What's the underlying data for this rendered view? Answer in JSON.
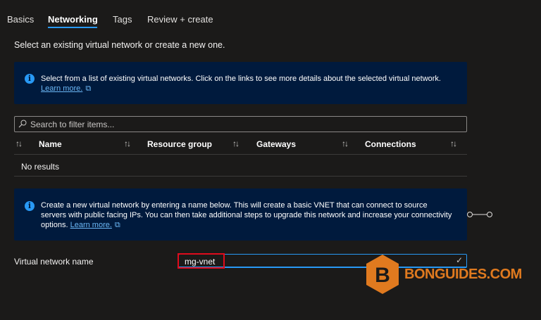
{
  "tabs": [
    {
      "label": "Basics",
      "active": false
    },
    {
      "label": "Networking",
      "active": true
    },
    {
      "label": "Tags",
      "active": false
    },
    {
      "label": "Review + create",
      "active": false
    }
  ],
  "intro_text": "Select an existing virtual network or create a new one.",
  "info_existing": {
    "text": "Select from a list of existing virtual networks. Click on the links to see more details about the selected virtual network.",
    "link": "Learn more."
  },
  "filter": {
    "placeholder": "Search to filter items..."
  },
  "table": {
    "columns": [
      "Name",
      "Resource group",
      "Gateways",
      "Connections"
    ],
    "empty_text": "No results"
  },
  "info_new": {
    "text": "Create a new virtual network by entering a name below. This will create a basic VNET that can connect to source servers with public facing IPs. You can then take additional steps to upgrade this network and increase your connectivity options.",
    "link": "Learn more."
  },
  "vnet_name": {
    "label": "Virtual network name",
    "value": "mg-vnet"
  },
  "watermark": {
    "text": "BONGUIDES.COM",
    "letter": "B"
  },
  "colors": {
    "accent": "#2899f5",
    "info_bg": "#001a3d",
    "highlight": "#e00b1c",
    "watermark": "#e07a1f"
  }
}
